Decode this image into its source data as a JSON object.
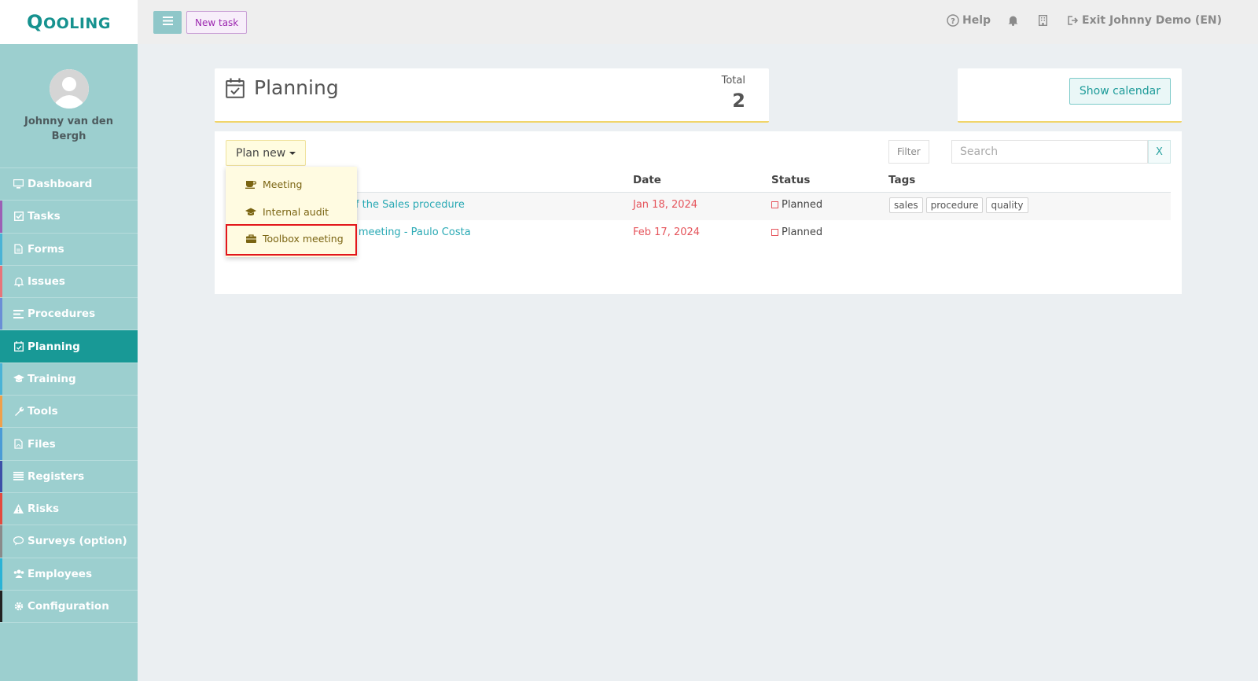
{
  "app": {
    "logo_text": "Qooling",
    "brand_color": "#16928f"
  },
  "user": {
    "name": "Johnny van den Bergh"
  },
  "sidebar": {
    "items": [
      {
        "label": "Dashboard",
        "icon": "monitor-icon",
        "color": "#9ccfcf",
        "active": false
      },
      {
        "label": "Tasks",
        "icon": "check-square-icon",
        "color": "#9c5fb5",
        "active": false
      },
      {
        "label": "Forms",
        "icon": "file-icon",
        "color": "#4ab3d6",
        "active": false
      },
      {
        "label": "Issues",
        "icon": "bell-icon",
        "color": "#e8747a",
        "active": false
      },
      {
        "label": "Procedures",
        "icon": "list-icon",
        "color": "#6a8ed6",
        "active": false
      },
      {
        "label": "Planning",
        "icon": "calendar-check-icon",
        "color": "#189996",
        "active": true
      },
      {
        "label": "Training",
        "icon": "graduation-cap-icon",
        "color": "#4ab3d6",
        "active": false
      },
      {
        "label": "Tools",
        "icon": "wrench-icon",
        "color": "#f0a04b",
        "active": false
      },
      {
        "label": "Files",
        "icon": "file-pdf-icon",
        "color": "#4a9bd6",
        "active": false
      },
      {
        "label": "Registers",
        "icon": "bars-icon",
        "color": "#3c4fa8",
        "active": false
      },
      {
        "label": "Risks",
        "icon": "warning-icon",
        "color": "#e34a3e",
        "active": false
      },
      {
        "label": "Surveys (option)",
        "icon": "comments-icon",
        "color": "#8a8a8a",
        "active": false
      },
      {
        "label": "Employees",
        "icon": "users-icon",
        "color": "#2ab3d6",
        "active": false
      },
      {
        "label": "Configuration",
        "icon": "gear-icon",
        "color": "#222222",
        "active": false
      }
    ]
  },
  "topbar": {
    "new_task_label": "New task",
    "help_label": "Help",
    "exit_label": "Exit Johnny Demo (EN)"
  },
  "header": {
    "title": "Planning",
    "total_label": "Total",
    "total_value": "2"
  },
  "calendar": {
    "show_label": "Show calendar"
  },
  "toolbar": {
    "plan_new_label": "Plan new",
    "filter_label": "Filter",
    "search_placeholder": "Search",
    "clear_label": "X"
  },
  "table": {
    "columns": [
      "Date",
      "Status",
      "Tags"
    ],
    "rows": [
      {
        "name": "of the Sales procedure",
        "date": "Jan 18, 2024",
        "status": "Planned",
        "tags": [
          "sales",
          "procedure",
          "quality"
        ]
      },
      {
        "name": "x meeting - Paulo Costa",
        "date": "Feb 17, 2024",
        "status": "Planned",
        "tags": []
      }
    ]
  },
  "dropdown": {
    "items": [
      {
        "label": "Meeting",
        "icon": "coffee-cup-icon"
      },
      {
        "label": "Internal audit",
        "icon": "graduation-cap-icon"
      },
      {
        "label": "Toolbox meeting",
        "icon": "briefcase-icon"
      }
    ]
  }
}
